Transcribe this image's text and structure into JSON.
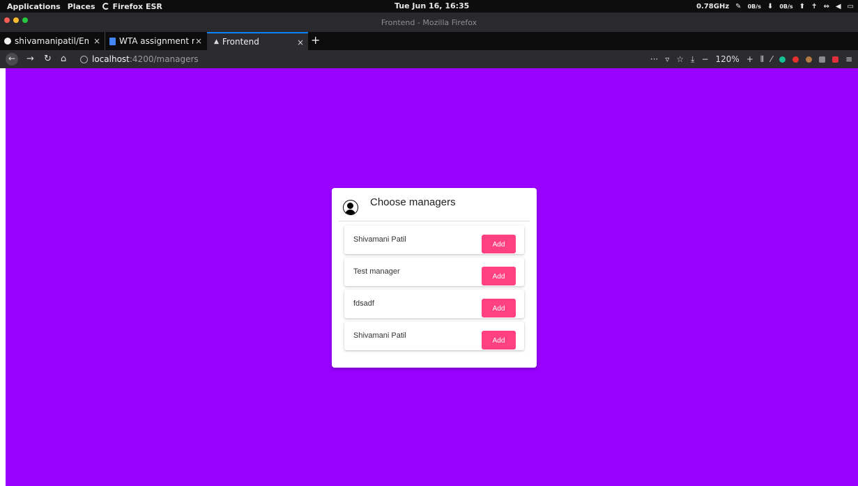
{
  "system_bar": {
    "applications": "Applications",
    "places": "Places",
    "firefox_esr": "Firefox ESR",
    "clock": "Tue Jun 16, 16:35",
    "cpu_freq": "0.78GHz",
    "net_down": "0B/s",
    "net_up": "0B/s"
  },
  "window": {
    "title": "Frontend - Mozilla Firefox"
  },
  "tabs": [
    {
      "label": "shivamanipatil/Emp",
      "icon": "github-icon"
    },
    {
      "label": "WTA assignment r",
      "icon": "google-docs-icon"
    },
    {
      "label": "Frontend",
      "icon": "angular-icon"
    }
  ],
  "navbar": {
    "url_host": "localhost",
    "url_path": ":4200/managers",
    "zoom": "120%"
  },
  "card": {
    "title": "Choose managers",
    "items": [
      {
        "name": "Shivamani Patil",
        "button": "Add"
      },
      {
        "name": "Test manager",
        "button": "Add"
      },
      {
        "name": "fdsadf",
        "button": "Add"
      },
      {
        "name": "Shivamani Patil",
        "button": "Add"
      }
    ]
  },
  "colors": {
    "page_background": "#9900ff",
    "add_button": "#ff4081"
  }
}
